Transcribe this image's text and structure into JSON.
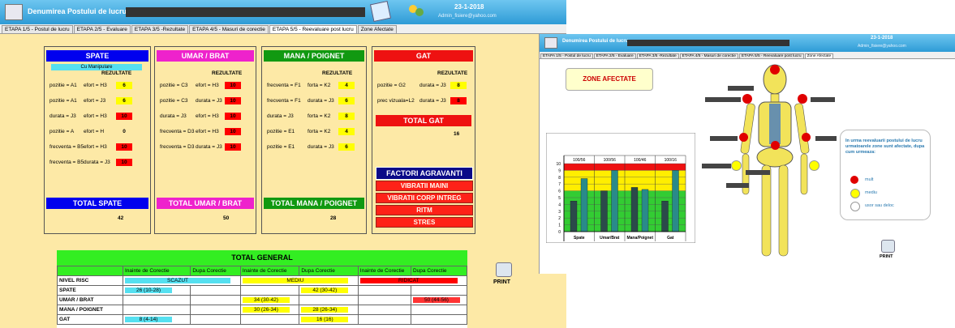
{
  "app": {
    "title": "Denumirea Postului de lucru",
    "date": "23-1-2018",
    "email": "Admin_fisiere@yahoo.com",
    "print": "PRINT"
  },
  "tabs": [
    "ETAPA 1/5 - Postul de lucru",
    "ETAPA 2/5 - Evaluare",
    "ETAPA 3/5 -Rezultate",
    "ETAPA 4/5 - Masuri de corectie",
    "ETAPA 5/5 - Reevaluare post lucru",
    "Zone Afectate"
  ],
  "rezultate": "REZULTATE",
  "spate": {
    "title": "SPATE",
    "sub": "Cu Manipulare",
    "rows": [
      {
        "a": "pozitie = A1",
        "b": "efort = H3",
        "v": "6",
        "c": "y"
      },
      {
        "a": "pozitie = A1",
        "b": "efort = J3",
        "v": "6",
        "c": "y"
      },
      {
        "a": "durata = J3",
        "b": "efort = H3",
        "v": "10",
        "c": "r"
      },
      {
        "a": "pozitie = A",
        "b": "efort = H",
        "v": "0",
        "c": ""
      },
      {
        "a": "frecventa = B5",
        "b": "efort = H3",
        "v": "10",
        "c": "r"
      },
      {
        "a": "frecventa = B5",
        "b": "durata = J3",
        "v": "10",
        "c": "r"
      }
    ],
    "total_label": "TOTAL SPATE",
    "total": "42"
  },
  "umar": {
    "title": "UMAR / BRAT",
    "rows": [
      {
        "a": "pozitie = C3",
        "b": "efort = H3",
        "v": "10",
        "c": "r"
      },
      {
        "a": "pozitie = C3",
        "b": "durata = J3",
        "v": "10",
        "c": "r"
      },
      {
        "a": "durata = J3",
        "b": "efort = H3",
        "v": "10",
        "c": "r"
      },
      {
        "a": "frecventa = D3",
        "b": "efort = H3",
        "v": "10",
        "c": "r"
      },
      {
        "a": "frecventa = D3",
        "b": "durata = J3",
        "v": "10",
        "c": "r"
      }
    ],
    "total_label": "TOTAL UMAR / BRAT",
    "total": "50"
  },
  "mana": {
    "title": "MANA / POIGNET",
    "rows": [
      {
        "a": "frecventa = F1",
        "b": "forta = K2",
        "v": "4",
        "c": "y"
      },
      {
        "a": "frecventa = F1",
        "b": "durata = J3",
        "v": "6",
        "c": "y"
      },
      {
        "a": "durata = J3",
        "b": "forta = K2",
        "v": "8",
        "c": "y"
      },
      {
        "a": "pozitie = E1",
        "b": "forta = K2",
        "v": "4",
        "c": "y"
      },
      {
        "a": "pozitie = E1",
        "b": "durata = J3",
        "v": "6",
        "c": "y"
      }
    ],
    "total_label": "TOTAL MANA / POIGNET",
    "total": "28"
  },
  "gat": {
    "title": "GAT",
    "rows": [
      {
        "a": "pozitie = G2",
        "b": "durata = J3",
        "v": "8",
        "c": "y"
      },
      {
        "a": "prec vizuala=L2",
        "b": "durata = J3",
        "v": "8",
        "c": "r"
      }
    ],
    "total_label": "TOTAL GAT",
    "total": "16"
  },
  "factori": {
    "title": "FACTORI AGRAVANTI",
    "items": [
      "VIBRATII MAINI",
      "VIBRATII CORP INTREG",
      "RITM",
      "STRES"
    ]
  },
  "total_general": {
    "title": "TOTAL GENERAL",
    "headers": [
      "Inainte de Corectie",
      "Dupa Corectie",
      "Inainte de Corectie",
      "Dupa Corectie",
      "Inainte de Corectie",
      "Dupa Corectie"
    ],
    "nivel_label": "NIVEL RISC",
    "nivel": [
      "SCAZUT",
      "MEDIU",
      "RIDICAT"
    ],
    "rows": [
      {
        "label": "SPATE",
        "cells": [
          "26 (10-28)",
          "",
          "",
          "42 (30-42)",
          "",
          ""
        ]
      },
      {
        "label": "UMAR / BRAT",
        "cells": [
          "",
          "",
          "34 (30-42)",
          "",
          "",
          "50 (44-56)"
        ]
      },
      {
        "label": "MANA / POIGNET",
        "cells": [
          "",
          "",
          "30 (26-34)",
          "28 (26-34)",
          "",
          ""
        ]
      },
      {
        "label": "GAT",
        "cells": [
          "8 (4-14)",
          "",
          "",
          "16 (16)",
          "",
          ""
        ]
      }
    ]
  },
  "zone": {
    "title": "ZONE AFECTATE",
    "note": "In urma reevaluarii postului de lucru urmatoarele zone sunt afectate, dupa cum urmeaza:",
    "legend": [
      "mult",
      "mediu",
      "usor sau deloc"
    ],
    "legend_colors": [
      "#e00000",
      "#ffff00",
      "#ffffff"
    ]
  },
  "chart_data": {
    "type": "bar",
    "categories": [
      "Spate",
      "Umar/Brat",
      "Mana/Poignet",
      "Gat"
    ],
    "header_labels": [
      "100/56",
      "100/56",
      "100/46",
      "100/16"
    ],
    "series": [
      {
        "values": [
          4.5,
          6,
          6.5,
          4.5
        ],
        "color": "#2b4a4a"
      },
      {
        "values": [
          7.8,
          9,
          6.2,
          9
        ],
        "color": "#2a8a8a"
      }
    ],
    "ylim": [
      0,
      10
    ],
    "yticks": [
      "0",
      "1",
      "2",
      "3",
      "4",
      "5",
      "6",
      "7",
      "8",
      "9",
      "10"
    ],
    "bands": [
      {
        "from": 0,
        "to": 6,
        "color": "#33cc33"
      },
      {
        "from": 6,
        "to": 9,
        "color": "#ffee00"
      },
      {
        "from": 9,
        "to": 10,
        "color": "#ee1111"
      }
    ]
  }
}
